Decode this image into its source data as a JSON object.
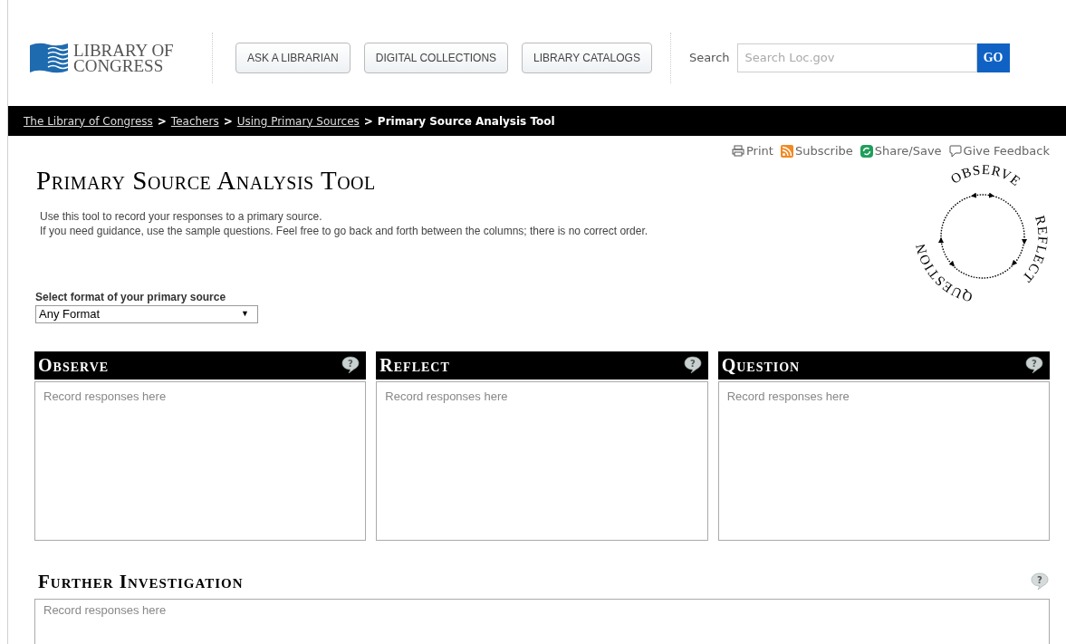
{
  "header": {
    "logo": {
      "line1": "LIBRARY OF",
      "line2": "CONGRESS"
    },
    "nav_buttons": [
      "ASK A LIBRARIAN",
      "DIGITAL COLLECTIONS",
      "LIBRARY CATALOGS"
    ],
    "search": {
      "label": "Search",
      "placeholder": "Search Loc.gov",
      "button": "GO"
    }
  },
  "breadcrumb": {
    "separator": ">",
    "items": [
      {
        "label": "The Library of Congress",
        "link": true
      },
      {
        "label": "Teachers",
        "link": true
      },
      {
        "label": "Using Primary Sources",
        "link": true
      },
      {
        "label": "Primary Source Analysis Tool",
        "link": false
      }
    ]
  },
  "actions": [
    {
      "label": "Print",
      "kind": "print"
    },
    {
      "label": "Subscribe",
      "kind": "rss"
    },
    {
      "label": "Share/Save",
      "kind": "share"
    },
    {
      "label": "Give Feedback",
      "kind": "feedback"
    }
  ],
  "title": "Primary Source Analysis Tool",
  "intro": [
    "Use this tool to record your responses to a primary source.",
    "If you need guidance, use the sample questions. Feel free to go back and forth between the columns; there is no correct order."
  ],
  "cycle_diagram": {
    "labels": [
      "OBSERVE",
      "REFLECT",
      "QUESTION"
    ]
  },
  "format_select": {
    "label": "Select format of your primary source",
    "value": "Any Format",
    "arrow": "▼"
  },
  "columns": [
    {
      "title": "Observe",
      "placeholder": "Record responses here",
      "help": "?"
    },
    {
      "title": "Reflect",
      "placeholder": "Record responses here",
      "help": "?"
    },
    {
      "title": "Question",
      "placeholder": "Record responses here",
      "help": "?"
    }
  ],
  "further": {
    "title": "Further Investigation",
    "placeholder": "Record responses here",
    "help": "?"
  }
}
